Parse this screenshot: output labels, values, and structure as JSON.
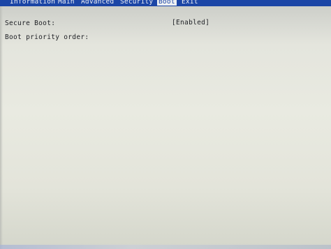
{
  "menubar": {
    "tabs": [
      {
        "label": "Information"
      },
      {
        "label": "Main"
      },
      {
        "label": "Advanced"
      },
      {
        "label": "Security"
      },
      {
        "label": "Boot"
      },
      {
        "label": "Exit"
      }
    ],
    "active_tab": "Boot"
  },
  "boot": {
    "secure_boot_label": "Secure Boot:",
    "secure_boot_value": "[Enabled]",
    "priority_label": "Boot priority order:"
  },
  "colors": {
    "menubar_background": "#1b45a6",
    "menubar_text": "#f2f3f7",
    "active_tab_background": "#eef0f2",
    "screen_background": "#e9eae1",
    "body_text": "#1d1f24"
  }
}
